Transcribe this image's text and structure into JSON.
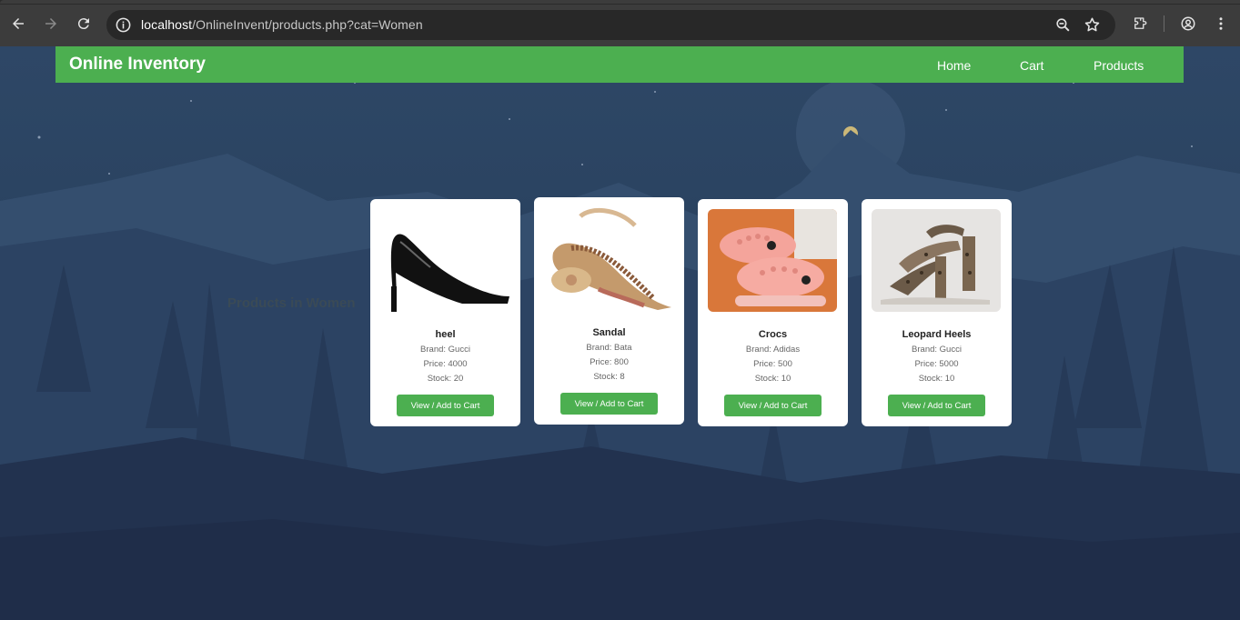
{
  "browser": {
    "url_host": "localhost",
    "url_path": "/OnlineInvent/products.php?cat=Women"
  },
  "site": {
    "brand": "Online Inventory",
    "nav": [
      "Home",
      "Cart",
      "Products"
    ]
  },
  "page": {
    "heading": "Products in Women"
  },
  "products": [
    {
      "name": "heel",
      "brand": "Brand: Gucci",
      "price": "Price: 4000",
      "stock": "Stock: 20",
      "button": "View / Add to Cart",
      "image": "black-heel-image"
    },
    {
      "name": "Sandal",
      "brand": "Brand: Bata",
      "price": "Price: 800",
      "stock": "Stock: 8",
      "button": "View / Add to Cart",
      "image": "sandal-image"
    },
    {
      "name": "Crocs",
      "brand": "Brand: Adidas",
      "price": "Price: 500",
      "stock": "Stock: 10",
      "button": "View / Add to Cart",
      "image": "pink-crocs-image"
    },
    {
      "name": "Leopard Heels",
      "brand": "Brand: Gucci",
      "price": "Price: 5000",
      "stock": "Stock: 10",
      "button": "View / Add to Cart",
      "image": "leopard-heels-image"
    }
  ],
  "colors": {
    "accent": "#4caf50",
    "chrome": "#3c3c3c",
    "omnibox": "#282828"
  }
}
